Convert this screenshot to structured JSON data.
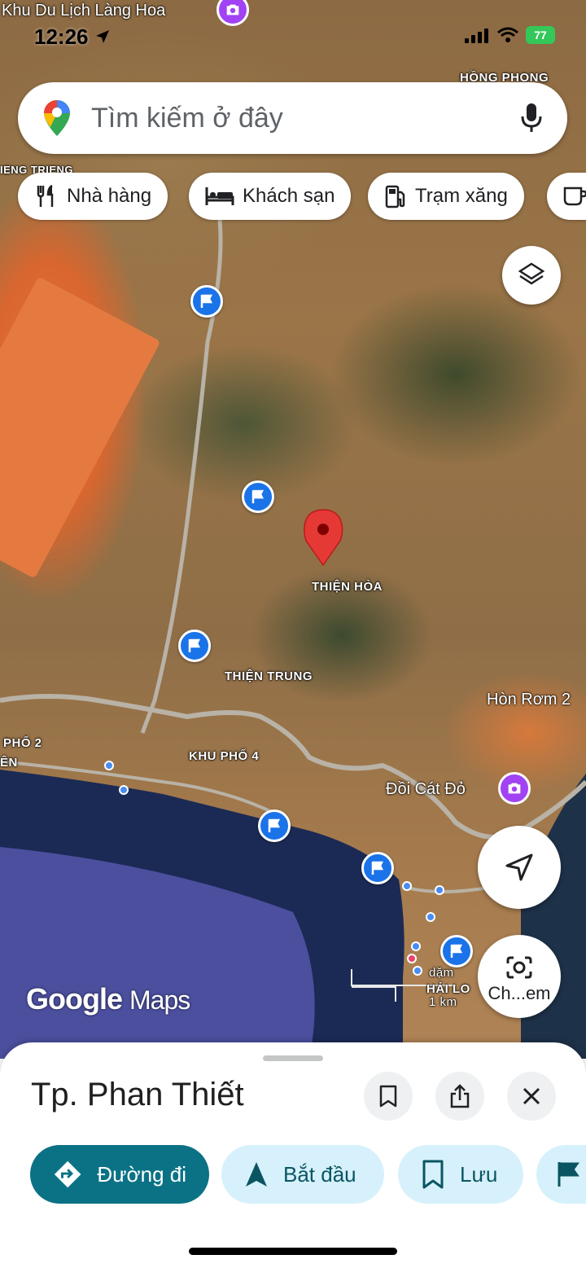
{
  "status_bar": {
    "time": "12:26",
    "battery": "77"
  },
  "top_place": {
    "name": "Khu Du Lịch Làng Hoa"
  },
  "search": {
    "placeholder": "Tìm kiếm ở đây"
  },
  "chips": [
    {
      "label": "Nhà hàng",
      "icon": "restaurant-icon"
    },
    {
      "label": "Khách sạn",
      "icon": "hotel-icon"
    },
    {
      "label": "Trạm xăng",
      "icon": "gas-station-icon"
    }
  ],
  "map": {
    "labels": {
      "hong_phong": "HỒNG PHONG",
      "tieng_trieng": "IENG TRIENG",
      "thien_hoa": "THIỆN HÒA",
      "thien_trung": "THIỆN TRUNG",
      "khu_pho_4": "KHU PHỐ 4",
      "pho_2": "PHỐ 2",
      "en": "ÊN",
      "hai_long": "HẢI LO",
      "hon_rom": "Hòn Rơm 2",
      "doi_cat_do": "Đồi Cát Đỏ"
    },
    "scale": {
      "top": "dặm",
      "bottom": "1 km"
    }
  },
  "google_logo": {
    "google": "Google",
    "maps": "Maps"
  },
  "camera_button": {
    "label": "Ch...em"
  },
  "sheet": {
    "title": "Tp. Phan Thiết",
    "actions": [
      {
        "label": "Đường đi",
        "icon": "directions-icon",
        "primary": true
      },
      {
        "label": "Bắt đầu",
        "icon": "navigation-arrow-icon",
        "primary": false
      },
      {
        "label": "Lưu",
        "icon": "bookmark-icon",
        "primary": false
      }
    ]
  },
  "colors": {
    "accent_primary": "#0b7285",
    "accent_light": "#d6f1fb",
    "parking_blue": "#1a73e8",
    "pin_red": "#e53935",
    "photo_purple": "#a142f4"
  }
}
